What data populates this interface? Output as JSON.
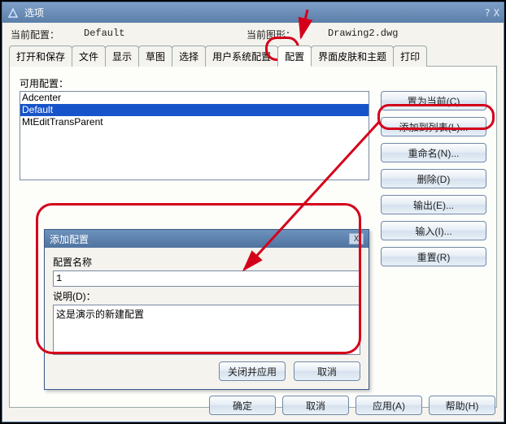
{
  "window": {
    "title": "选项",
    "help_glyph": "?",
    "close_glyph": "X"
  },
  "header": {
    "current_profile_label": "当前配置：",
    "current_profile_value": "Default",
    "current_drawing_label": "当前图形：",
    "current_drawing_value": "Drawing2.dwg"
  },
  "tabs": [
    {
      "label": "打开和保存"
    },
    {
      "label": "文件"
    },
    {
      "label": "显示"
    },
    {
      "label": "草图"
    },
    {
      "label": "选择"
    },
    {
      "label": "用户系统配置"
    },
    {
      "label": "配置"
    },
    {
      "label": "界面皮肤和主题"
    },
    {
      "label": "打印"
    }
  ],
  "profiles": {
    "label": "可用配置：",
    "items": [
      {
        "name": "Adcenter",
        "selected": false
      },
      {
        "name": "Default",
        "selected": true
      },
      {
        "name": "MtEditTransParent",
        "selected": false
      }
    ]
  },
  "side_buttons": {
    "set_current": "置为当前(C)",
    "add_to_list": "添加到列表(L)...",
    "rename": "重命名(N)...",
    "delete": "删除(D)",
    "export": "输出(E)...",
    "import": "输入(I)...",
    "reset": "重置(R)"
  },
  "modal": {
    "title": "添加配置",
    "name_label": "配置名称",
    "name_value": "1",
    "desc_label": "说明(D)：",
    "desc_value": "这是演示的新建配置",
    "apply_close": "关闭并应用",
    "cancel": "取消",
    "close_glyph": "X"
  },
  "footer": {
    "ok": "确定",
    "cancel": "取消",
    "apply": "应用(A)",
    "help": "帮助(H)"
  }
}
